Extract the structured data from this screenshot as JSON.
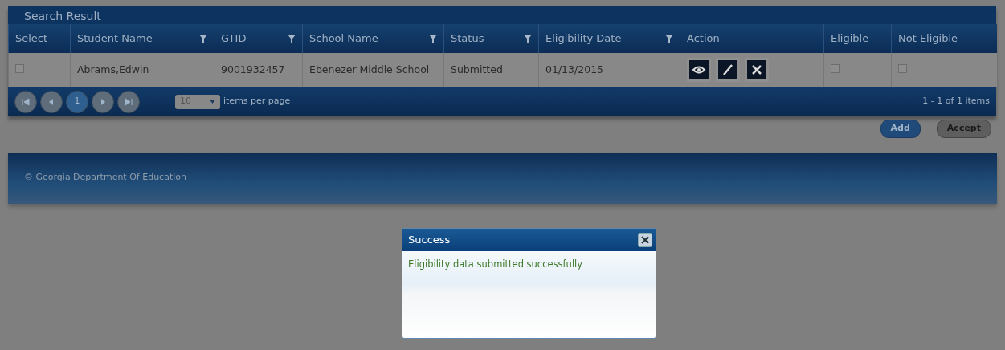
{
  "grid": {
    "title": "Search Result",
    "columns": [
      {
        "label": "Select",
        "filter": false
      },
      {
        "label": "Student Name",
        "filter": true
      },
      {
        "label": "GTID",
        "filter": true
      },
      {
        "label": "School Name",
        "filter": true
      },
      {
        "label": "Status",
        "filter": true
      },
      {
        "label": "Eligibility Date",
        "filter": true
      },
      {
        "label": "Action",
        "filter": false
      },
      {
        "label": "Eligible",
        "filter": false
      },
      {
        "label": "Not Eligible",
        "filter": false
      }
    ],
    "rows": [
      {
        "checked": false,
        "student_name": "Abrams,Edwin",
        "gtid": "9001932457",
        "school_name": "Ebenezer Middle School",
        "status": "Submitted",
        "eligibility_date": "01/13/2015",
        "actions": [
          {
            "kind": "view"
          },
          {
            "kind": "edit"
          },
          {
            "kind": "delete"
          }
        ],
        "eligible": false,
        "not_eligible": false
      }
    ],
    "pager": {
      "buttons": [
        {
          "kind": "first"
        },
        {
          "kind": "prev"
        },
        {
          "kind": "page",
          "label": "1",
          "selected": true
        },
        {
          "kind": "next"
        },
        {
          "kind": "last"
        }
      ],
      "page_size": "10",
      "page_size_label": "items per page",
      "summary": "1 - 1 of 1 items"
    }
  },
  "buttons": [
    {
      "label": "Add",
      "disabled": false
    },
    {
      "label": "Accept",
      "disabled": true
    }
  ],
  "footer": {
    "text": "© Georgia Department Of Education"
  },
  "dialog": {
    "title": "Success",
    "message": "Eligibility data submitted successfully"
  }
}
